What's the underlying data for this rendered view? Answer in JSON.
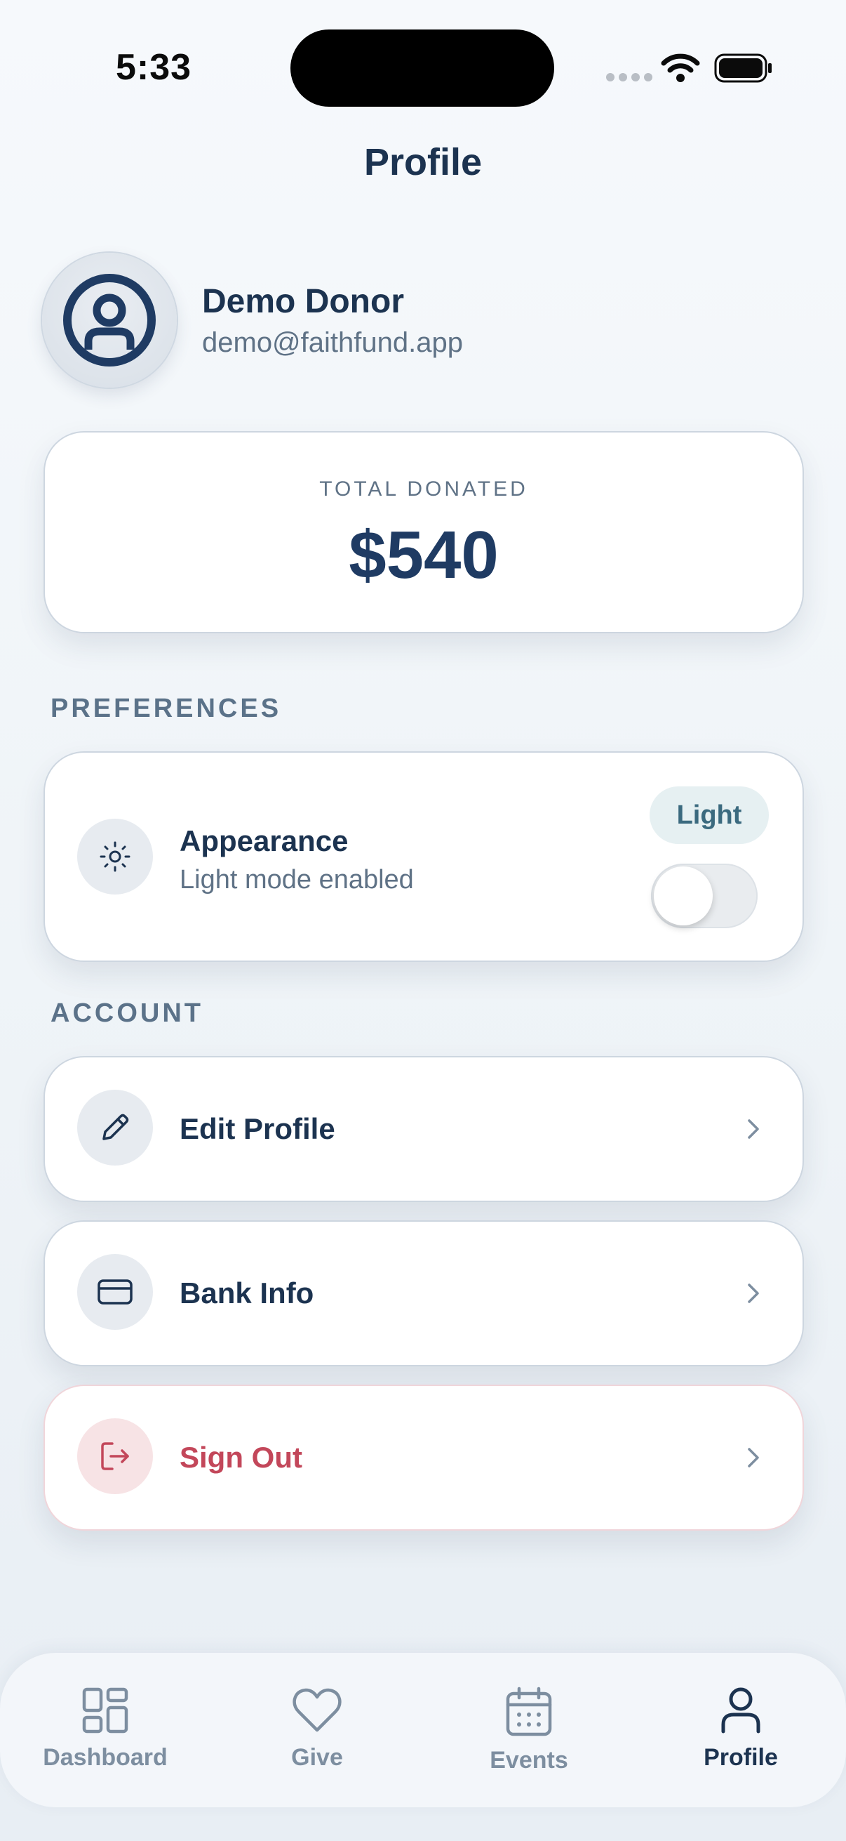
{
  "status_bar": {
    "time": "5:33"
  },
  "header": {
    "title": "Profile"
  },
  "profile": {
    "name": "Demo Donor",
    "email": "demo@faithfund.app"
  },
  "total": {
    "label": "TOTAL DONATED",
    "amount": "$540"
  },
  "sections": {
    "preferences": "PREFERENCES",
    "account": "ACCOUNT"
  },
  "appearance": {
    "title": "Appearance",
    "subtitle": "Light mode enabled",
    "mode_badge": "Light",
    "dark_mode_on": false
  },
  "account_items": [
    {
      "label": "Edit Profile",
      "icon": "pencil-icon"
    },
    {
      "label": "Bank Info",
      "icon": "card-icon"
    },
    {
      "label": "Sign Out",
      "icon": "logout-icon"
    }
  ],
  "tabs": [
    {
      "label": "Dashboard",
      "icon": "grid-icon",
      "active": false
    },
    {
      "label": "Give",
      "icon": "heart-icon",
      "active": false
    },
    {
      "label": "Events",
      "icon": "calendar-icon",
      "active": false
    },
    {
      "label": "Profile",
      "icon": "person-icon",
      "active": true
    }
  ],
  "colors": {
    "primary": "#1c3350",
    "accent": "#1f3b63",
    "danger": "#c3475a",
    "muted": "#5f7286"
  }
}
